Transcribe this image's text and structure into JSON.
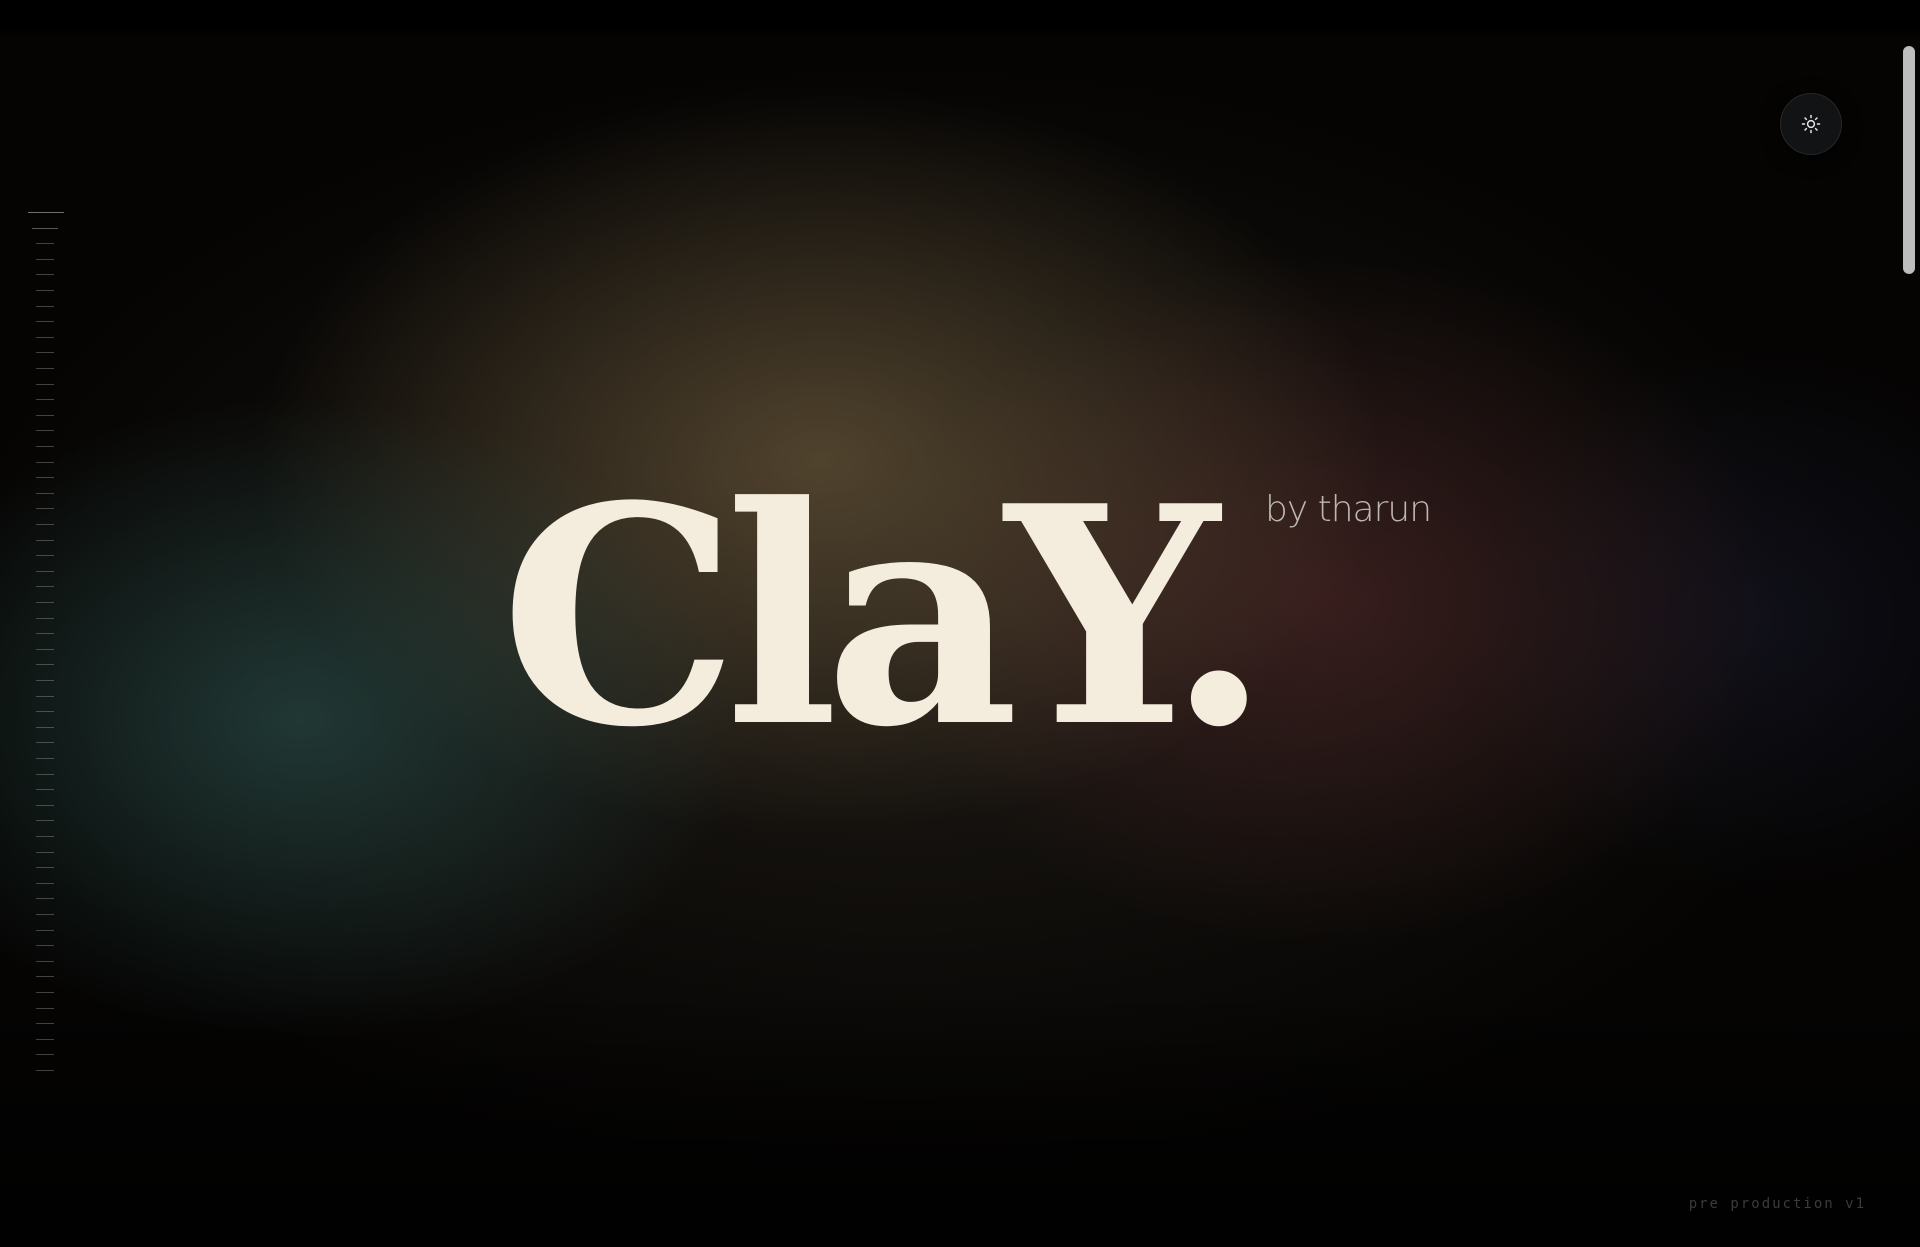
{
  "brand": {
    "title": "ClaY.",
    "byline": "by tharun"
  },
  "footer": {
    "version": "pre production v1"
  },
  "theme_toggle": {
    "icon": "sun-icon"
  },
  "scroll_position": 0,
  "colors": {
    "background": "#050403",
    "title": "#f4ecdd",
    "byline": "#bcb7b0",
    "version": "#3b3b3b",
    "glow_teal": "#305c58",
    "glow_gold": "#746040",
    "glow_maroon": "#602e30",
    "button": "#121314",
    "scroll_thumb": "#bdbdbd"
  }
}
